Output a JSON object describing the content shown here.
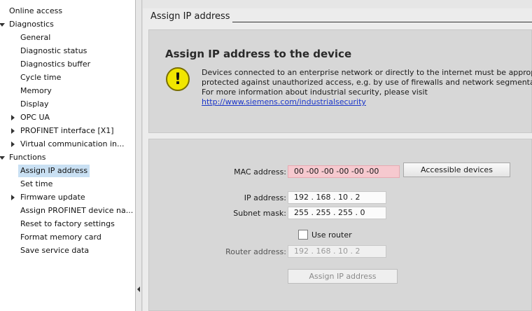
{
  "nav": {
    "items": [
      {
        "label": "Online access",
        "level": 0,
        "arrow": "none",
        "selected": false
      },
      {
        "label": "Diagnostics",
        "level": 0,
        "arrow": "down",
        "selected": false
      },
      {
        "label": "General",
        "level": 1,
        "arrow": "none",
        "selected": false
      },
      {
        "label": "Diagnostic status",
        "level": 1,
        "arrow": "none",
        "selected": false
      },
      {
        "label": "Diagnostics buffer",
        "level": 1,
        "arrow": "none",
        "selected": false
      },
      {
        "label": "Cycle time",
        "level": 1,
        "arrow": "none",
        "selected": false
      },
      {
        "label": "Memory",
        "level": 1,
        "arrow": "none",
        "selected": false
      },
      {
        "label": "Display",
        "level": 1,
        "arrow": "none",
        "selected": false
      },
      {
        "label": "OPC UA",
        "level": 1,
        "arrow": "right",
        "selected": false
      },
      {
        "label": "PROFINET interface [X1]",
        "level": 1,
        "arrow": "right",
        "selected": false
      },
      {
        "label": "Virtual communication in...",
        "level": 1,
        "arrow": "right",
        "selected": false
      },
      {
        "label": "Functions",
        "level": 0,
        "arrow": "down",
        "selected": false
      },
      {
        "label": "Assign IP address",
        "level": 1,
        "arrow": "none",
        "selected": true
      },
      {
        "label": "Set time",
        "level": 1,
        "arrow": "none",
        "selected": false
      },
      {
        "label": "Firmware update",
        "level": 1,
        "arrow": "right",
        "selected": false
      },
      {
        "label": "Assign PROFINET device na...",
        "level": 1,
        "arrow": "none",
        "selected": false
      },
      {
        "label": "Reset to factory settings",
        "level": 1,
        "arrow": "none",
        "selected": false
      },
      {
        "label": "Format memory card",
        "level": 1,
        "arrow": "none",
        "selected": false
      },
      {
        "label": "Save service data",
        "level": 1,
        "arrow": "none",
        "selected": false
      }
    ]
  },
  "section": {
    "header": "Assign IP address"
  },
  "info": {
    "title": "Assign IP address to the device",
    "warning_glyph": "!",
    "line1": "Devices connected to an enterprise network or directly to the internet must be appropr",
    "line2": "protected against unauthorized access, e.g. by use of firewalls and network segmentati",
    "line3": "For more information about industrial security, please visit",
    "link": "http://www.siemens.com/industrialsecurity"
  },
  "form": {
    "mac_label": "MAC address:",
    "mac_value": "00 -00 -00 -00 -00 -00",
    "accessible_button": "Accessible devices",
    "ip_label": "IP address:",
    "ip_value": "192  .  168  .  10   .   2",
    "subnet_label": "Subnet mask:",
    "subnet_value": "255  .  255  .  255  .  0",
    "use_router_label": "Use router",
    "use_router_checked": false,
    "router_label": "Router address:",
    "router_value": "192  .  168  .  10   .   2",
    "assign_button": "Assign IP address"
  },
  "colors": {
    "selected_bg": "#c9e0f3",
    "mac_field_bg": "#f6c9cf",
    "warning_yellow": "#f1e600",
    "link": "#1a35c8"
  }
}
